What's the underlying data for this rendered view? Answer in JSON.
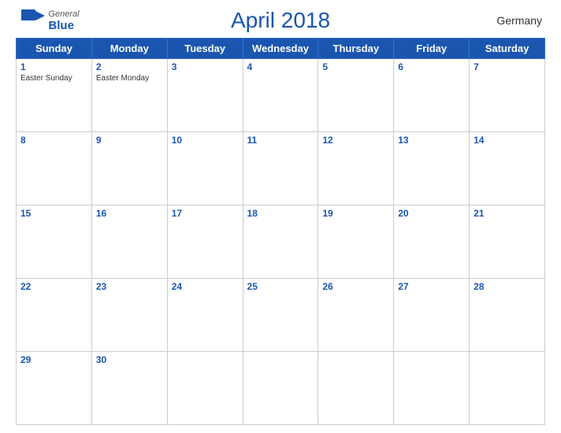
{
  "header": {
    "title": "April 2018",
    "country": "Germany",
    "logo": {
      "general": "General",
      "blue": "Blue"
    }
  },
  "weekdays": [
    "Sunday",
    "Monday",
    "Tuesday",
    "Wednesday",
    "Thursday",
    "Friday",
    "Saturday"
  ],
  "weeks": [
    [
      {
        "day": "1",
        "holiday": "Easter Sunday"
      },
      {
        "day": "2",
        "holiday": "Easter Monday"
      },
      {
        "day": "3",
        "holiday": ""
      },
      {
        "day": "4",
        "holiday": ""
      },
      {
        "day": "5",
        "holiday": ""
      },
      {
        "day": "6",
        "holiday": ""
      },
      {
        "day": "7",
        "holiday": ""
      }
    ],
    [
      {
        "day": "8",
        "holiday": ""
      },
      {
        "day": "9",
        "holiday": ""
      },
      {
        "day": "10",
        "holiday": ""
      },
      {
        "day": "11",
        "holiday": ""
      },
      {
        "day": "12",
        "holiday": ""
      },
      {
        "day": "13",
        "holiday": ""
      },
      {
        "day": "14",
        "holiday": ""
      }
    ],
    [
      {
        "day": "15",
        "holiday": ""
      },
      {
        "day": "16",
        "holiday": ""
      },
      {
        "day": "17",
        "holiday": ""
      },
      {
        "day": "18",
        "holiday": ""
      },
      {
        "day": "19",
        "holiday": ""
      },
      {
        "day": "20",
        "holiday": ""
      },
      {
        "day": "21",
        "holiday": ""
      }
    ],
    [
      {
        "day": "22",
        "holiday": ""
      },
      {
        "day": "23",
        "holiday": ""
      },
      {
        "day": "24",
        "holiday": ""
      },
      {
        "day": "25",
        "holiday": ""
      },
      {
        "day": "26",
        "holiday": ""
      },
      {
        "day": "27",
        "holiday": ""
      },
      {
        "day": "28",
        "holiday": ""
      }
    ],
    [
      {
        "day": "29",
        "holiday": ""
      },
      {
        "day": "30",
        "holiday": ""
      },
      {
        "day": "",
        "holiday": ""
      },
      {
        "day": "",
        "holiday": ""
      },
      {
        "day": "",
        "holiday": ""
      },
      {
        "day": "",
        "holiday": ""
      },
      {
        "day": "",
        "holiday": ""
      }
    ]
  ]
}
